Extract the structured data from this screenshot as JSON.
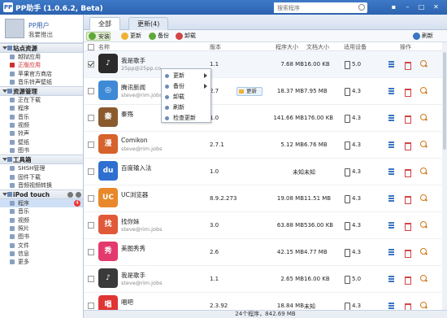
{
  "window": {
    "title": "PP助手 (1.0.6.2, Beta)",
    "logo": "PP"
  },
  "search": {
    "placeholder": "搜索程序"
  },
  "window_controls": [
    "▪",
    "–",
    "□",
    "✕"
  ],
  "tabs": [
    {
      "label": "全部"
    },
    {
      "label": "更新(4)"
    }
  ],
  "user": {
    "name": "PP用户",
    "logout": "我要推出"
  },
  "sidebar": {
    "sections": [
      {
        "title": "站点资源",
        "items": [
          "越狱应用",
          "正版应用",
          "苹果官方商店",
          "音乐铃声壁纸"
        ]
      },
      {
        "title": "资源管理",
        "items": [
          "正在下载",
          "程序",
          "音乐",
          "视频",
          "铃声",
          "壁纸",
          "图书"
        ]
      },
      {
        "title": "工具箱",
        "items": [
          "SHSH管理",
          "固件下载",
          "音频视频转换"
        ]
      },
      {
        "title": "iPod touch",
        "items": [
          "程序",
          "音乐",
          "视频",
          "照片",
          "图书",
          "文件",
          "信息",
          "更多"
        ]
      }
    ],
    "program_badge": "4"
  },
  "toolbar": {
    "install": "安装",
    "update": "更新",
    "backup": "备份",
    "uninstall": "卸载",
    "refresh": "刷新"
  },
  "table": {
    "headers": {
      "name": "名称",
      "version": "版本",
      "program_size": "程序大小",
      "doc_size": "文档大小",
      "device": "适用设备",
      "ops": "操作"
    },
    "rows": [
      {
        "name": "我是歌手",
        "sub": "25pp@25pp.co...",
        "version": "1.1",
        "psize": "7.68 MB",
        "dsize": "16.00 KB",
        "device": "5.0",
        "icon_color": "#2b2b2b",
        "icon_text": "♪"
      },
      {
        "name": "腾讯新闻",
        "sub": "steve@rim.jobs",
        "version": "2.7",
        "psize": "18.37 MB",
        "dsize": "7.95 MB",
        "device": "4.3",
        "icon_color": "#3f8ad6",
        "icon_text": "◎",
        "update": "更新"
      },
      {
        "name": "秦殇",
        "sub": "",
        "version": "1.0",
        "psize": "141.66 MB",
        "dsize": "176.00 KB",
        "device": "4.3",
        "icon_color": "#8a5a2e",
        "icon_text": "秦"
      },
      {
        "name": "Comikon",
        "sub": "steve@rim.jobs",
        "version": "2.7.1",
        "psize": "5.12 MB",
        "dsize": "6.76 MB",
        "device": "4.3",
        "icon_color": "#d6622c",
        "icon_text": "漫"
      },
      {
        "name": "百度输入法",
        "sub": "",
        "version": "1.0",
        "psize": "未知",
        "dsize": "未知",
        "device": "4.3",
        "icon_color": "#2f6fd0",
        "icon_text": "du"
      },
      {
        "name": "UC浏览器",
        "sub": "",
        "version": "8.9.2.273",
        "psize": "19.08 MB",
        "dsize": "11.51 MB",
        "device": "4.3",
        "icon_color": "#e8882a",
        "icon_text": "UC"
      },
      {
        "name": "找你妹",
        "sub": "steve@rim.jobs",
        "version": "3.0",
        "psize": "63.88 MB",
        "dsize": "536.00 KB",
        "device": "4.3",
        "icon_color": "#e05a3a",
        "icon_text": "找"
      },
      {
        "name": "美图秀秀",
        "sub": "",
        "version": "2.6",
        "psize": "42.15 MB",
        "dsize": "4.77 MB",
        "device": "4.3",
        "icon_color": "#e33a6e",
        "icon_text": "秀"
      },
      {
        "name": "我是歌手",
        "sub": "steve@rim.jobs",
        "version": "1.1",
        "psize": "2.65 MB",
        "dsize": "16.00 KB",
        "device": "5.0",
        "icon_color": "#3a3a3a",
        "icon_text": "♪"
      },
      {
        "name": "唱吧",
        "sub": "",
        "version": "2.3.92",
        "psize": "18.84 MB",
        "dsize": "未知",
        "device": "4.3",
        "icon_color": "#e03535",
        "icon_text": "唱"
      }
    ]
  },
  "context_menu": {
    "items": [
      "更新",
      "备份",
      "卸载",
      "刷新",
      "检查更新"
    ]
  },
  "status": "24个程序，842.69 MB",
  "colors": {
    "titlebar": "#2c63b0",
    "accent": "#3a74c2",
    "badge": "#e33333"
  }
}
